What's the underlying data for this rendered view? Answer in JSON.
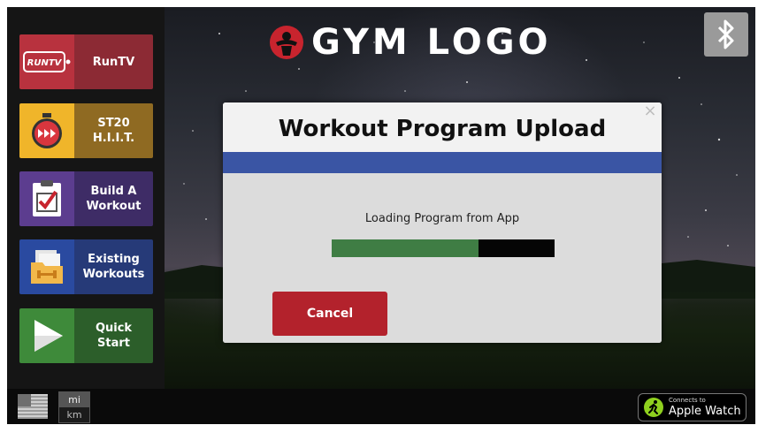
{
  "brand": {
    "logo_text": "GYM LOGO"
  },
  "sidebar": {
    "items": [
      {
        "label": "RunTV",
        "icon": "runtv-icon"
      },
      {
        "label": "ST20\nH.I.I.T.",
        "icon": "stopwatch-icon"
      },
      {
        "label": "Build A\nWorkout",
        "icon": "clipboard-check-icon"
      },
      {
        "label": "Existing\nWorkouts",
        "icon": "folder-dumbbell-icon"
      },
      {
        "label": "Quick\nStart",
        "icon": "play-icon"
      }
    ],
    "runtv_icon_text": "RUNTV"
  },
  "modal": {
    "title": "Workout Program Upload",
    "status": "Loading Program from App",
    "progress": 0.66,
    "cancel_label": "Cancel",
    "close_glyph": "×"
  },
  "footer": {
    "units": {
      "primary": "mi",
      "secondary": "km"
    },
    "apple_watch": {
      "line1": "Connects to",
      "line2": "Apple Watch"
    }
  },
  "colors": {
    "accent_blue": "#3a55a4",
    "cancel_red": "#b3222c",
    "progress_green": "#3f7d44"
  }
}
